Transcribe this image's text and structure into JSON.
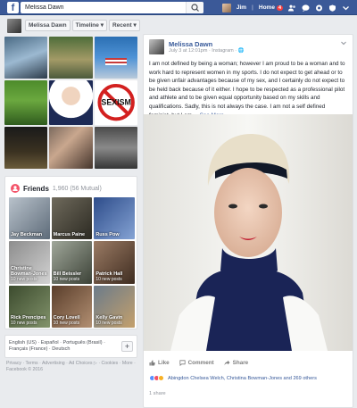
{
  "topbar": {
    "search_value": "Melissa Dawn",
    "user_name": "Jim",
    "home_label": "Home",
    "home_badge": "4",
    "colors": {
      "brand": "#3b5998",
      "badge": "#fa3e3e"
    }
  },
  "profile_nav": {
    "name_tab": "Melissa Dawn",
    "timeline_tab": "Timeline",
    "recent_tab": "Recent"
  },
  "photo_grid": {
    "sexism_text": "SEXISM"
  },
  "friends": {
    "title": "Friends",
    "count": "1,960 (56 Mutual)",
    "items": [
      {
        "name": "Jay Beckman",
        "sub": ""
      },
      {
        "name": "Marcus Paine",
        "sub": ""
      },
      {
        "name": "Russ Pow",
        "sub": ""
      },
      {
        "name": "Christine Bowman-Jones",
        "sub": "10 new posts"
      },
      {
        "name": "Bill Beissler",
        "sub": "10 new posts"
      },
      {
        "name": "Patrick Hall",
        "sub": "10 new posts"
      },
      {
        "name": "Rick Prencipes",
        "sub": "10 new posts"
      },
      {
        "name": "Cory Lovell",
        "sub": "10 new posts"
      },
      {
        "name": "Kelly Gavin",
        "sub": "10 new posts"
      }
    ]
  },
  "language": {
    "text": "English (US) · Español · Português (Brasil) · Français (France) · Deutsch",
    "plus": "+"
  },
  "footer": {
    "text": "Privacy · Terms · Advertising · Ad Choices ▷ · Cookies · More · Facebook © 2016"
  },
  "post": {
    "author": "Melissa Dawn",
    "meta": "July 3 at 12:01pm · Instagram · 🌐",
    "body": "I am not defined by being a woman; however I am proud to be a woman and to work hard to represent women in my sports. I do not expect to get ahead or to be given unfair advantages because of my sex, and I certainly do not expect to be held back because of it either. I hope to be respected as a professional pilot and athlete and to be given equal opportunity based on my skills and qualifications. Sadly, this is not always the case. I am not a self defined feminist, but I am ...",
    "see_more": "See More",
    "like_label": "Like",
    "comment_label": "Comment",
    "share_label": "Share",
    "reactions_text": "Abingdon Chelsea Welch, Christina Bowman-Jones and 269 others",
    "shares_text": "1 share"
  }
}
